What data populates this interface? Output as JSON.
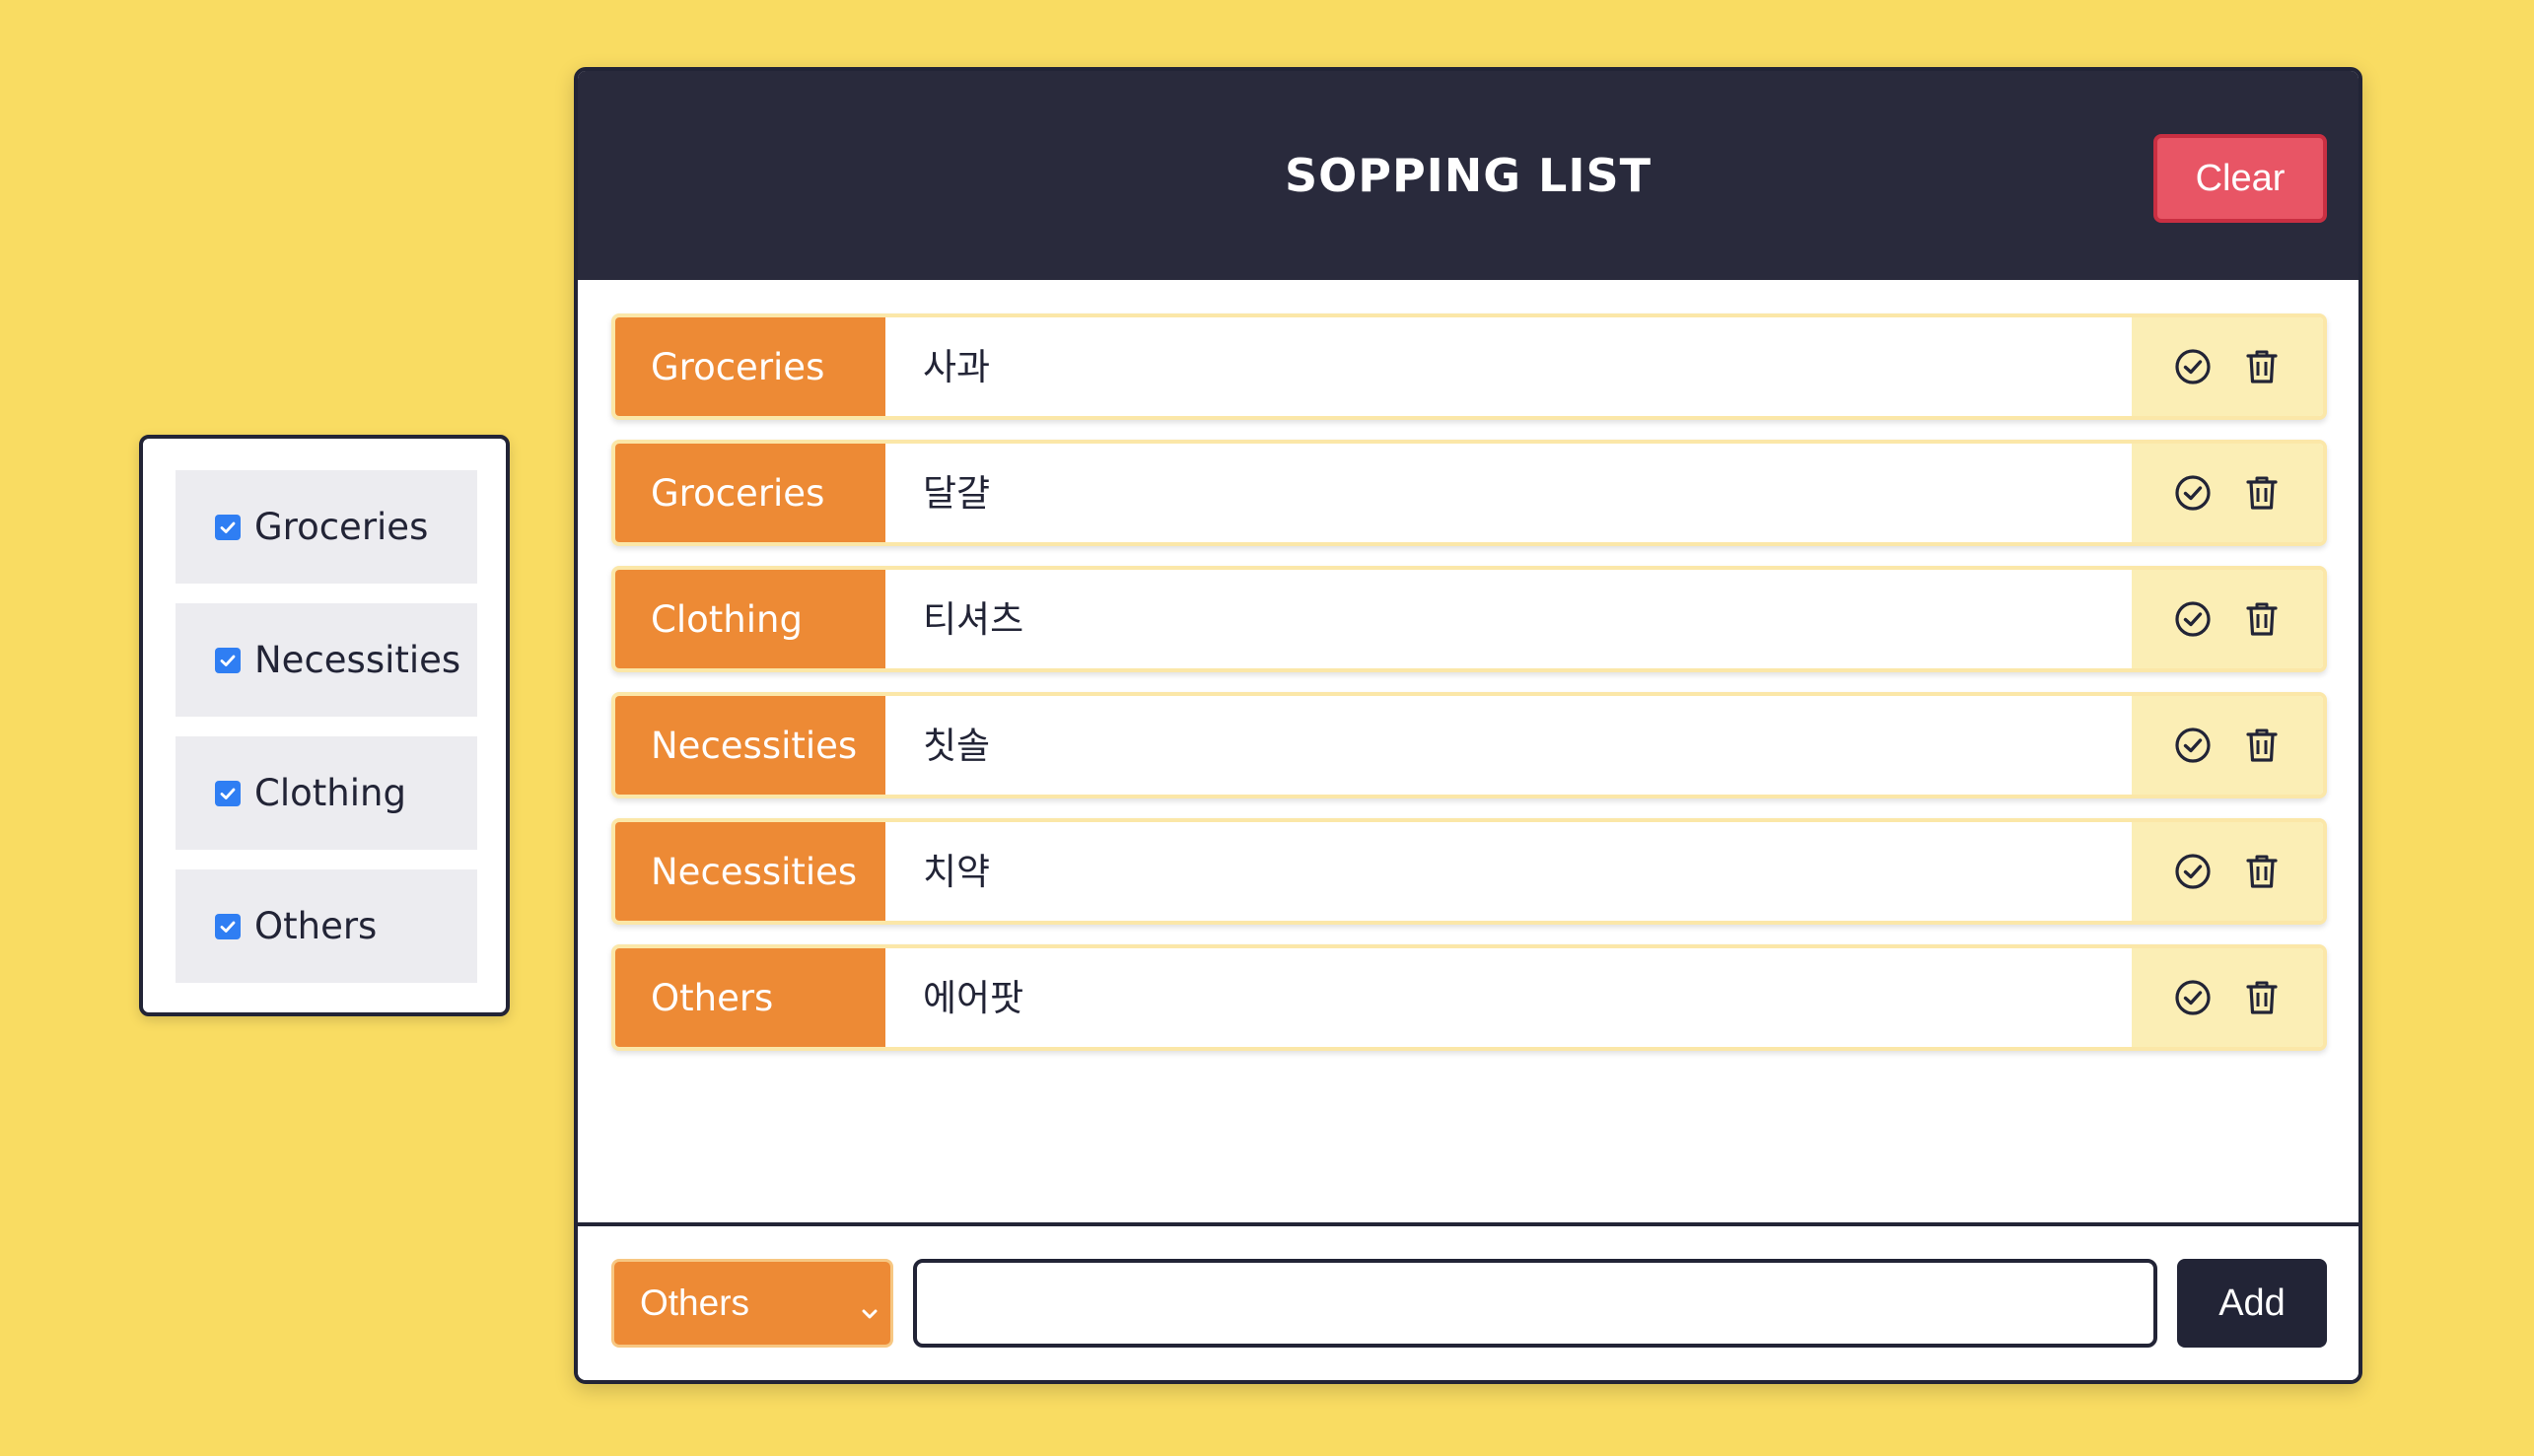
{
  "colors": {
    "background": "#f9dc62",
    "header": "#292a3c",
    "accent": "#ed8a35",
    "clear": "#e85565",
    "checkbox": "#2f7ef3",
    "actions_bg": "#fbeeb5"
  },
  "filters": [
    {
      "label": "Groceries",
      "checked": true
    },
    {
      "label": "Necessities",
      "checked": true
    },
    {
      "label": "Clothing",
      "checked": true
    },
    {
      "label": "Others",
      "checked": true
    }
  ],
  "header": {
    "title": "SOPPING LIST",
    "clear_label": "Clear"
  },
  "items": [
    {
      "category": "Groceries",
      "name": "사과",
      "icons": [
        "check-circle-icon",
        "trash-icon"
      ]
    },
    {
      "category": "Groceries",
      "name": "달걀",
      "icons": [
        "check-circle-icon",
        "trash-icon"
      ]
    },
    {
      "category": "Clothing",
      "name": "티셔츠",
      "icons": [
        "check-circle-icon",
        "trash-icon"
      ]
    },
    {
      "category": "Necessities",
      "name": "칫솔",
      "icons": [
        "check-circle-icon",
        "trash-icon"
      ]
    },
    {
      "category": "Necessities",
      "name": "치약",
      "icons": [
        "check-circle-icon",
        "trash-icon"
      ]
    },
    {
      "category": "Others",
      "name": "에어팟",
      "icons": [
        "check-circle-icon",
        "trash-icon"
      ]
    }
  ],
  "footer": {
    "selected_category": "Others",
    "input_value": "",
    "input_placeholder": "",
    "add_label": "Add"
  }
}
